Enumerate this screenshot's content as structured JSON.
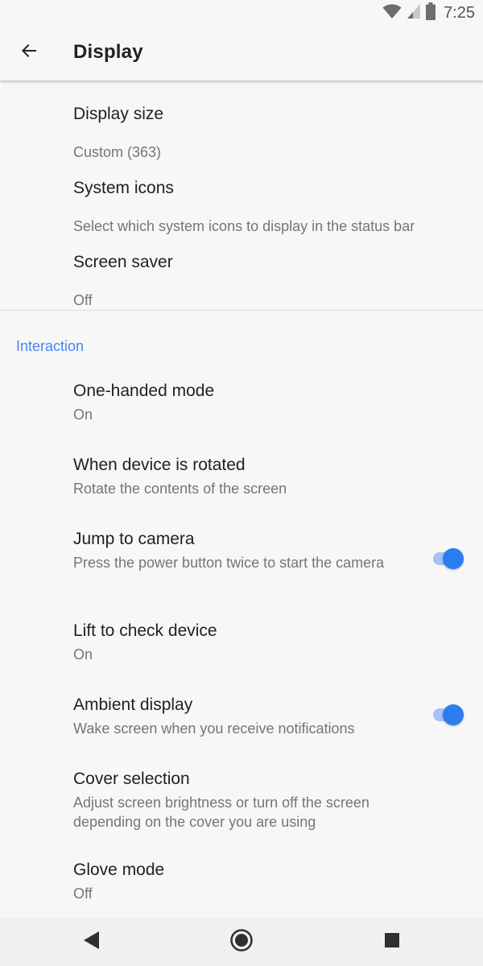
{
  "status_bar": {
    "time": "7:25",
    "icons": [
      "wifi-icon",
      "signal-icon",
      "battery-icon"
    ]
  },
  "app_bar": {
    "back_icon": "arrow-back-icon",
    "title": "Display"
  },
  "settings": {
    "display_size": {
      "title": "Display size",
      "subtitle": "Custom (363)"
    },
    "system_icons": {
      "title": "System icons",
      "subtitle": "Select which system icons to display in the status bar"
    },
    "screen_saver": {
      "title": "Screen saver",
      "subtitle": "Off"
    }
  },
  "interaction": {
    "header": "Interaction",
    "one_handed": {
      "title": "One-handed mode",
      "subtitle": "On"
    },
    "rotated": {
      "title": "When device is rotated",
      "subtitle": "Rotate the contents of the screen"
    },
    "jump_camera": {
      "title": "Jump to camera",
      "subtitle": "Press the power button twice to start the camera",
      "enabled": true
    },
    "lift_check": {
      "title": "Lift to check device",
      "subtitle": "On"
    },
    "ambient": {
      "title": "Ambient display",
      "subtitle": "Wake screen when you receive notifications",
      "enabled": true
    },
    "cover_selection": {
      "title": "Cover selection",
      "subtitle": "Adjust screen brightness or turn off the screen depending on the cover you are using"
    },
    "glove_mode": {
      "title": "Glove mode",
      "subtitle": "Off"
    }
  },
  "nav_bar": {
    "icons": [
      "back-triangle-icon",
      "home-circle-icon",
      "recents-square-icon"
    ]
  },
  "colors": {
    "accent": "#4285f4",
    "toggle_thumb": "#2c7cf2",
    "toggle_track": "#a4c2f5"
  }
}
